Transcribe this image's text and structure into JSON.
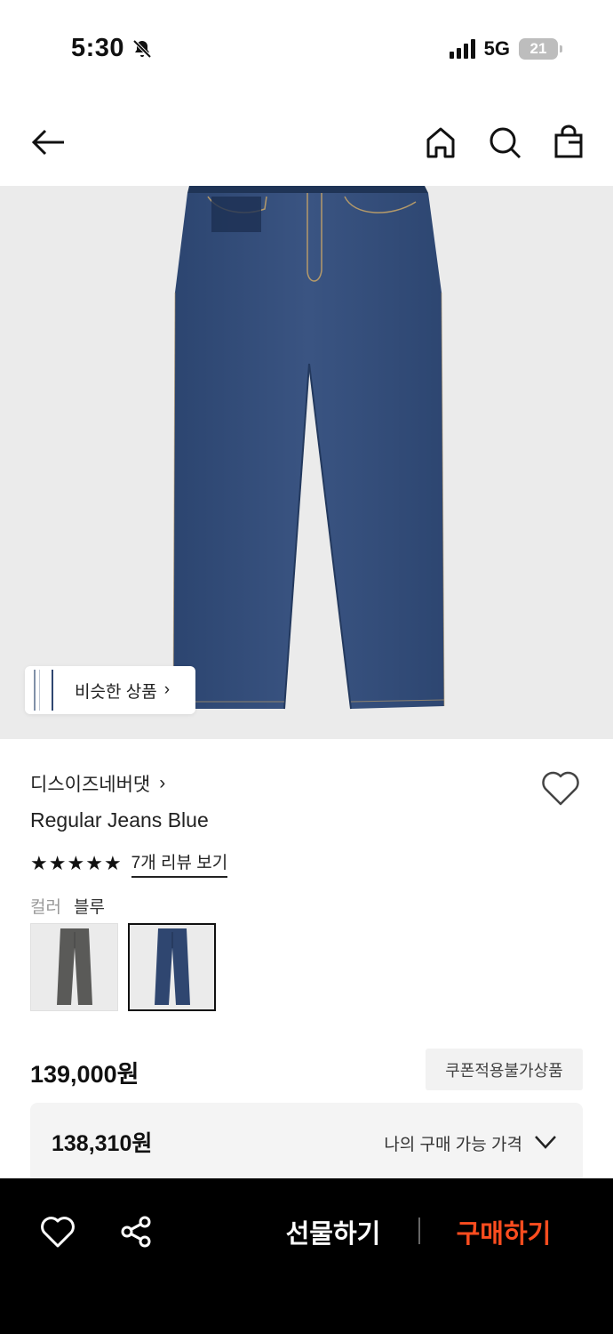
{
  "status_bar": {
    "time": "5:30",
    "network": "5G",
    "battery": "21"
  },
  "nav": {
    "back_icon": "arrow-left-icon",
    "home_icon": "home-icon",
    "search_icon": "search-icon",
    "cart_icon": "shopping-bag-icon"
  },
  "gallery": {
    "similar_label": "비슷한 상품",
    "similar_chevron": "›"
  },
  "product": {
    "brand": "디스이즈네버댓",
    "brand_chevron": "›",
    "name": "Regular Jeans Blue",
    "rating_stars": 5,
    "review_link": "7개 리뷰 보기",
    "color_label": "컬러",
    "color_value": "블루",
    "swatches": [
      {
        "name": "grey-jeans",
        "color": "#5a5a58",
        "selected": false
      },
      {
        "name": "blue-jeans",
        "color": "#2f4670",
        "selected": true
      }
    ],
    "price": "139,000원",
    "coupon_badge": "쿠폰적용불가상품",
    "my_price_value": "138,310원",
    "my_price_label": "나의 구매 가능 가격"
  },
  "bottom_bar": {
    "wish_icon": "heart-icon",
    "share_icon": "share-icon",
    "gift_label": "선물하기",
    "buy_label": "구매하기",
    "buy_color": "#ff4d1f"
  },
  "colors": {
    "image_bg": "#ebebeb",
    "denim": "#2f4670"
  }
}
